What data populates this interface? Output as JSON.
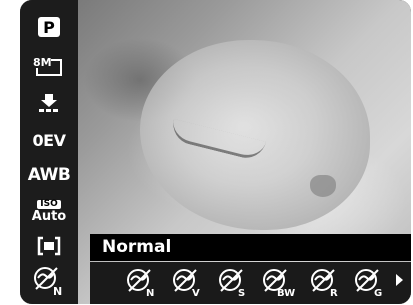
{
  "left_menu": {
    "items": [
      {
        "name": "scene-mode-p",
        "label": "P"
      },
      {
        "name": "image-size-8m",
        "label": "8M"
      },
      {
        "name": "quality",
        "label": ""
      },
      {
        "name": "exposure",
        "label": "0EV"
      },
      {
        "name": "white-balance",
        "label": "AWB"
      },
      {
        "name": "iso",
        "label_top": "ISO",
        "label_bottom": "Auto"
      },
      {
        "name": "metering",
        "label": ""
      },
      {
        "name": "color-effect",
        "label": "N"
      }
    ]
  },
  "color_effect": {
    "selected_label": "Normal",
    "options": [
      {
        "icon": "color-normal-icon",
        "sub": "N"
      },
      {
        "icon": "color-vivid-icon",
        "sub": "V"
      },
      {
        "icon": "color-sepia-icon",
        "sub": "S"
      },
      {
        "icon": "color-bw-icon",
        "sub": "BW"
      },
      {
        "icon": "color-red-icon",
        "sub": "R"
      },
      {
        "icon": "color-green-icon",
        "sub": "G"
      }
    ]
  }
}
